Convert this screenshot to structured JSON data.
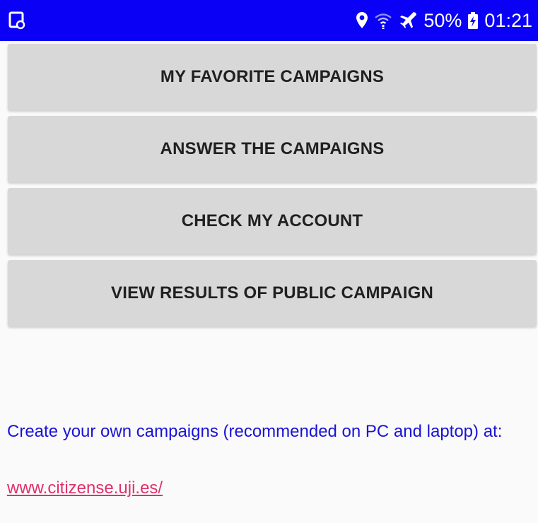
{
  "status_bar": {
    "battery_percent": "50%",
    "time": "01:21",
    "left_icon": "screenshot-notification-icon",
    "icons": [
      "location-icon",
      "wifi-icon",
      "airplane-mode-icon",
      "battery-charging-icon"
    ],
    "background_color": "#0a00f5"
  },
  "menu": {
    "buttons": [
      {
        "label": "MY FAVORITE CAMPAIGNS"
      },
      {
        "label": "ANSWER THE CAMPAIGNS"
      },
      {
        "label": "CHECK MY ACCOUNT"
      },
      {
        "label": "VIEW RESULTS OF PUBLIC CAMPAIGN"
      }
    ]
  },
  "footer": {
    "text": "Create your own campaigns (recommended on PC and laptop) at:",
    "link": "www.citizense.uji.es/",
    "text_color": "#1a12d6",
    "link_color": "#e0306a"
  }
}
